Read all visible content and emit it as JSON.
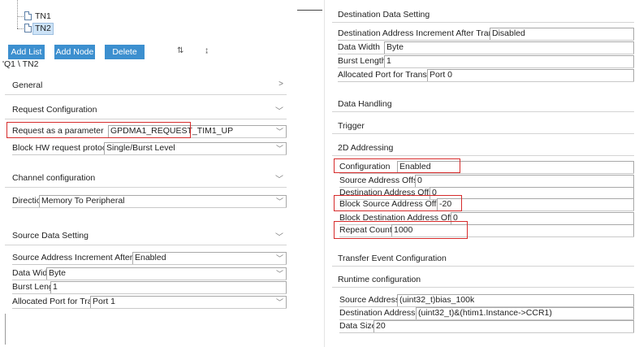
{
  "tree": {
    "nodes": [
      {
        "label": "TN1",
        "selected": false
      },
      {
        "label": "TN2",
        "selected": true
      }
    ]
  },
  "toolbar": {
    "add_list": "Add List",
    "add_node": "Add Node",
    "delete": "Delete",
    "sort_az_icon": "sort-ascending-icon",
    "sort_za_icon": "sort-descending-icon"
  },
  "breadcrumb": "'Q1 \\ TN2",
  "left": {
    "general": "General",
    "request_configuration": "Request Configuration",
    "request_param_label": "Request as a parameter",
    "request_param_value": "GPDMA1_REQUEST_TIM1_UP",
    "block_hw_label": "Block HW request protocol",
    "block_hw_value": "Single/Burst Level",
    "channel_configuration": "Channel configuration",
    "direction_label": "Direction",
    "direction_value": "Memory To Peripheral",
    "source_data_setting": "Source Data Setting",
    "src_increment_label": "Source Address Increment After Transfer",
    "src_increment_value": "Enabled",
    "src_width_label": "Data Width",
    "src_width_value": "Byte",
    "src_burst_label": "Burst Length",
    "src_burst_value": "1",
    "src_port_label": "Allocated Port for Transfer",
    "src_port_value": "Port 1"
  },
  "right": {
    "destination_data_setting": "Destination Data Setting",
    "dst_increment_label": "Destination Address Increment After Transfer",
    "dst_increment_value": "Disabled",
    "dst_width_label": "Data Width",
    "dst_width_value": "Byte",
    "dst_burst_label": "Burst Length",
    "dst_burst_value": "1",
    "dst_port_label": "Allocated Port for Transfer",
    "dst_port_value": "Port 0",
    "data_handling": "Data Handling",
    "trigger": "Trigger",
    "addressing_2d": "2D Addressing",
    "configuration_label": "Configuration",
    "configuration_value": "Enabled",
    "src_offset_label": "Source Address Offset",
    "src_offset_value": "0",
    "dst_offset_label": "Destination Address Offset",
    "dst_offset_value": "0",
    "block_src_offset_label": "Block Source Address Offset",
    "block_src_offset_value": "-20",
    "block_dst_offset_label": "Block Destination Address Offset",
    "block_dst_offset_value": "0",
    "repeat_counter_label": "Repeat Counter",
    "repeat_counter_value": "1000",
    "transfer_event_configuration": "Transfer Event Configuration",
    "runtime_configuration": "Runtime configuration",
    "source_address_label": "Source Address",
    "source_address_value": "(uint32_t)bias_100k",
    "destination_address_label": "Destination Address",
    "destination_address_value": "(uint32_t)&(htim1.Instance->CCR1)",
    "data_size_label": "Data Size",
    "data_size_value": "20"
  },
  "colors": {
    "button_blue": "#3c8fcf",
    "highlight_red": "#d62b2b",
    "selection_blue": "#cde3f7"
  }
}
